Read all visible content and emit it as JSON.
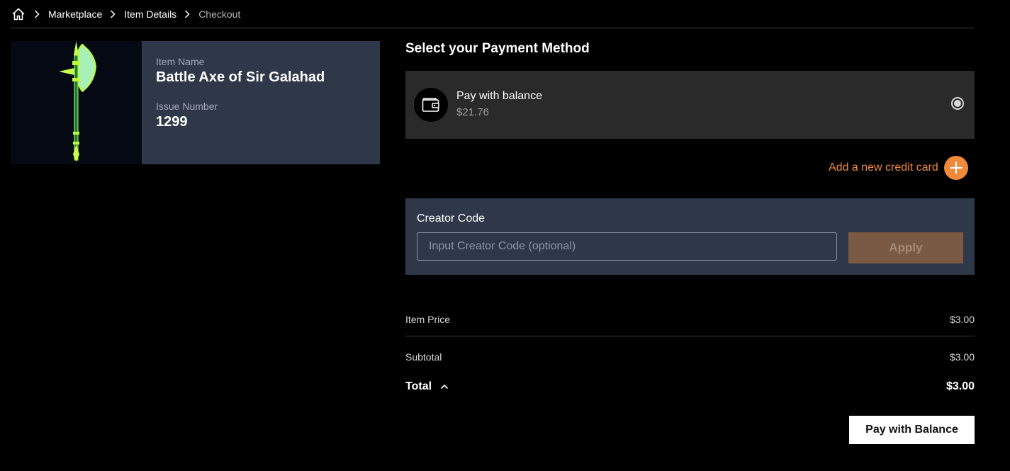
{
  "breadcrumb": {
    "home_icon": "home-icon",
    "items": [
      {
        "label": "Marketplace"
      },
      {
        "label": "Item Details"
      },
      {
        "label": "Checkout"
      }
    ]
  },
  "item": {
    "name_label": "Item Name",
    "name": "Battle Axe of Sir Galahad",
    "issue_label": "Issue Number",
    "issue_number": "1299",
    "image_icon": "battle-axe-icon"
  },
  "payment": {
    "title": "Select your Payment Method",
    "balance_option": {
      "label": "Pay with balance",
      "amount": "$21.76",
      "icon": "wallet-icon",
      "selected": true
    },
    "add_card_label": "Add a new credit card"
  },
  "creator_code": {
    "label": "Creator Code",
    "placeholder": "Input Creator Code (optional)",
    "value": "",
    "apply_label": "Apply"
  },
  "summary": {
    "item_price_label": "Item Price",
    "item_price_value": "$3.00",
    "subtotal_label": "Subtotal",
    "subtotal_value": "$3.00",
    "total_label": "Total",
    "total_value": "$3.00"
  },
  "pay_button_label": "Pay with Balance",
  "colors": {
    "accent_orange": "#f0893a",
    "card_bg": "#2f3849",
    "option_bg": "#2a2a2a",
    "background": "#000000"
  }
}
